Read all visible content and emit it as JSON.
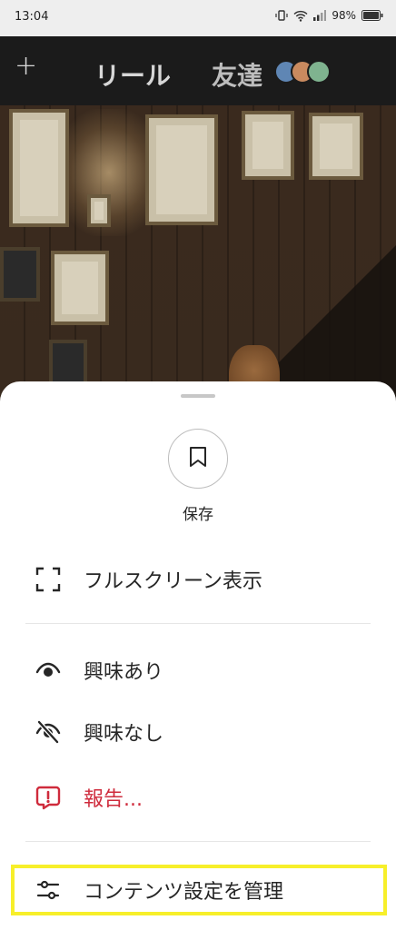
{
  "status_bar": {
    "time": "13:04",
    "battery": "98%"
  },
  "nav": {
    "add_symbol": "+",
    "reels_label": "リール",
    "friends_label": "友達",
    "friend_avatar_colors": [
      "#5f86b4",
      "#c98a5f",
      "#7fb38f"
    ]
  },
  "sheet": {
    "save_label": "保存",
    "items": [
      {
        "label": "フルスクリーン表示",
        "icon": "fullscreen-icon"
      },
      {
        "label": "興味あり",
        "icon": "eye-icon"
      },
      {
        "label": "興味なし",
        "icon": "eye-slash-icon"
      },
      {
        "label": "報告...",
        "icon": "report-icon"
      },
      {
        "label": "コンテンツ設定を管理",
        "icon": "sliders-icon"
      }
    ]
  },
  "colors": {
    "danger": "#cf2b3c",
    "highlight": "#f7ef2a",
    "text": "#262626"
  }
}
